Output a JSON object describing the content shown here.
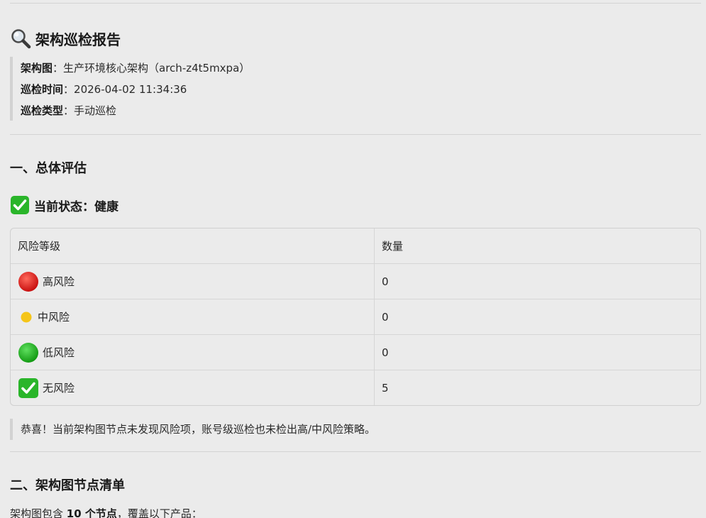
{
  "report": {
    "title": "架构巡检报告",
    "meta": [
      {
        "label": "架构图",
        "sep": "：",
        "value": "生产环境核心架构（arch-z4t5mxpa）"
      },
      {
        "label": "巡检时间",
        "sep": "：",
        "value": "2026-04-02 11:34:36"
      },
      {
        "label": "巡检类型",
        "sep": "：",
        "value": "手动巡检"
      }
    ]
  },
  "section1": {
    "heading": "一、总体评估",
    "status_text": "当前状态：健康",
    "table": {
      "headers": [
        "风险等级",
        "数量"
      ],
      "rows": [
        {
          "icon": "red-circle-icon",
          "level": "高风险",
          "count": "0"
        },
        {
          "icon": "yellow-circle-icon",
          "level": "中风险",
          "count": "0"
        },
        {
          "icon": "green-circle-icon",
          "level": "低风险",
          "count": "0"
        },
        {
          "icon": "check-mark-icon",
          "level": "无风险",
          "count": "5"
        }
      ]
    },
    "note": "恭喜！当前架构图节点未发现风险项，账号级巡检也未检出高/中风险策略。"
  },
  "section2": {
    "heading": "二、架构图节点清单",
    "intro_prefix": "架构图包含",
    "intro_bold": "10 个节点",
    "intro_suffix": "，覆盖以下产品："
  },
  "colors": {
    "background": "#ebebeb",
    "high_risk": "#e02020",
    "mid_risk": "#f5c518",
    "low_risk": "#1faa1f",
    "check": "#2ab52a"
  }
}
